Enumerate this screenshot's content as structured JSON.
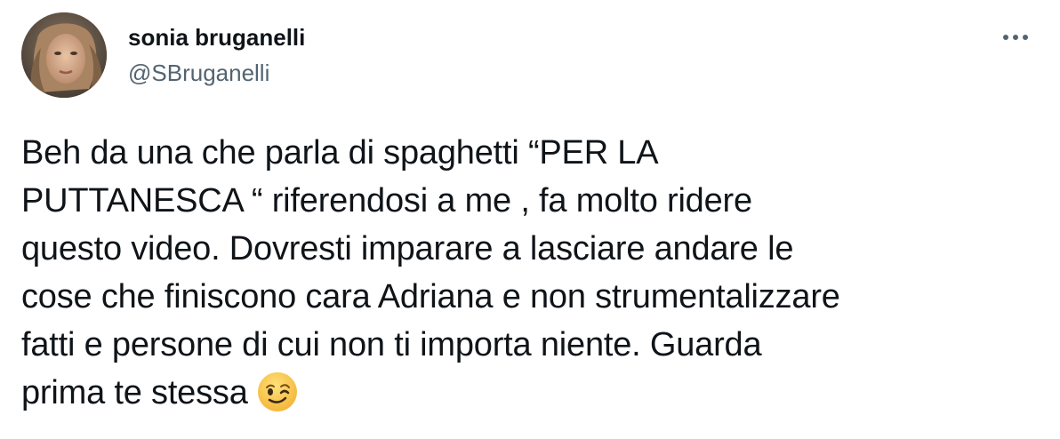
{
  "user": {
    "display_name": "sonia bruganelli",
    "handle": "@SBruganelli"
  },
  "more_icon": "more-horizontal-icon",
  "tweet": {
    "lines": [
      "Beh da una che parla di spaghetti “PER LA",
      "PUTTANESCA “ riferendosi a me , fa molto ridere",
      "questo video. Dovresti imparare a lasciare andare le",
      "cose che finiscono cara Adriana e non strumentalizzare",
      "fatti e persone di cui non ti importa niente. Guarda",
      "prima te stessa"
    ],
    "emoji": "winking-face-emoji"
  },
  "colors": {
    "text": "#0f1419",
    "secondary": "#536471",
    "emoji_yellow": "#f8c232"
  }
}
